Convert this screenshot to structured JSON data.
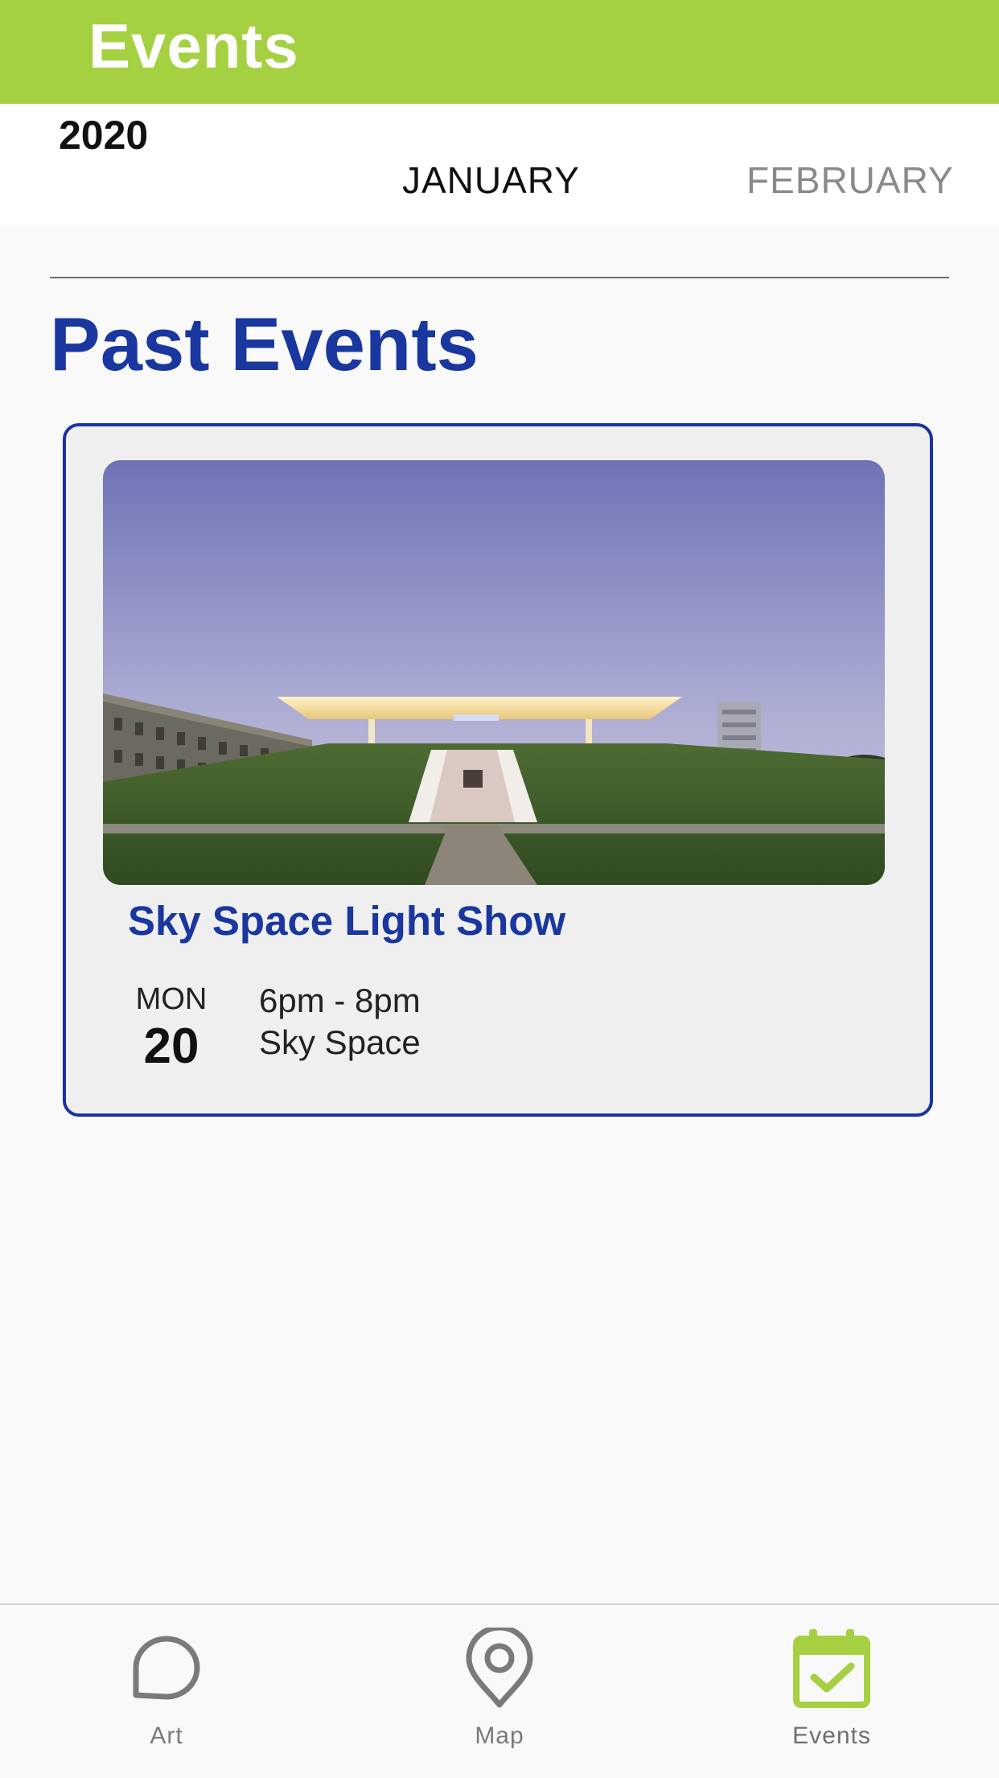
{
  "header": {
    "title": "Events",
    "background_color": "#a5d041"
  },
  "calendar": {
    "year": "2020",
    "months": [
      {
        "label": "JANUARY",
        "selected": true
      },
      {
        "label": "FEBRUARY",
        "selected": false
      }
    ]
  },
  "main": {
    "section_title": "Past Events",
    "accent_color": "#1a37a0",
    "events": [
      {
        "title": "Sky Space Light Show",
        "weekday": "MON",
        "day": "20",
        "time": "6pm - 8pm",
        "location": "Sky Space",
        "image_icon": "skyspace-photo"
      }
    ]
  },
  "tab_bar": {
    "active_color": "#a5d041",
    "tabs": [
      {
        "label": "Art",
        "icon": "chat-bubble-icon",
        "active": false
      },
      {
        "label": "Map",
        "icon": "map-pin-icon",
        "active": false
      },
      {
        "label": "Events",
        "icon": "calendar-check-icon",
        "active": true
      }
    ]
  }
}
